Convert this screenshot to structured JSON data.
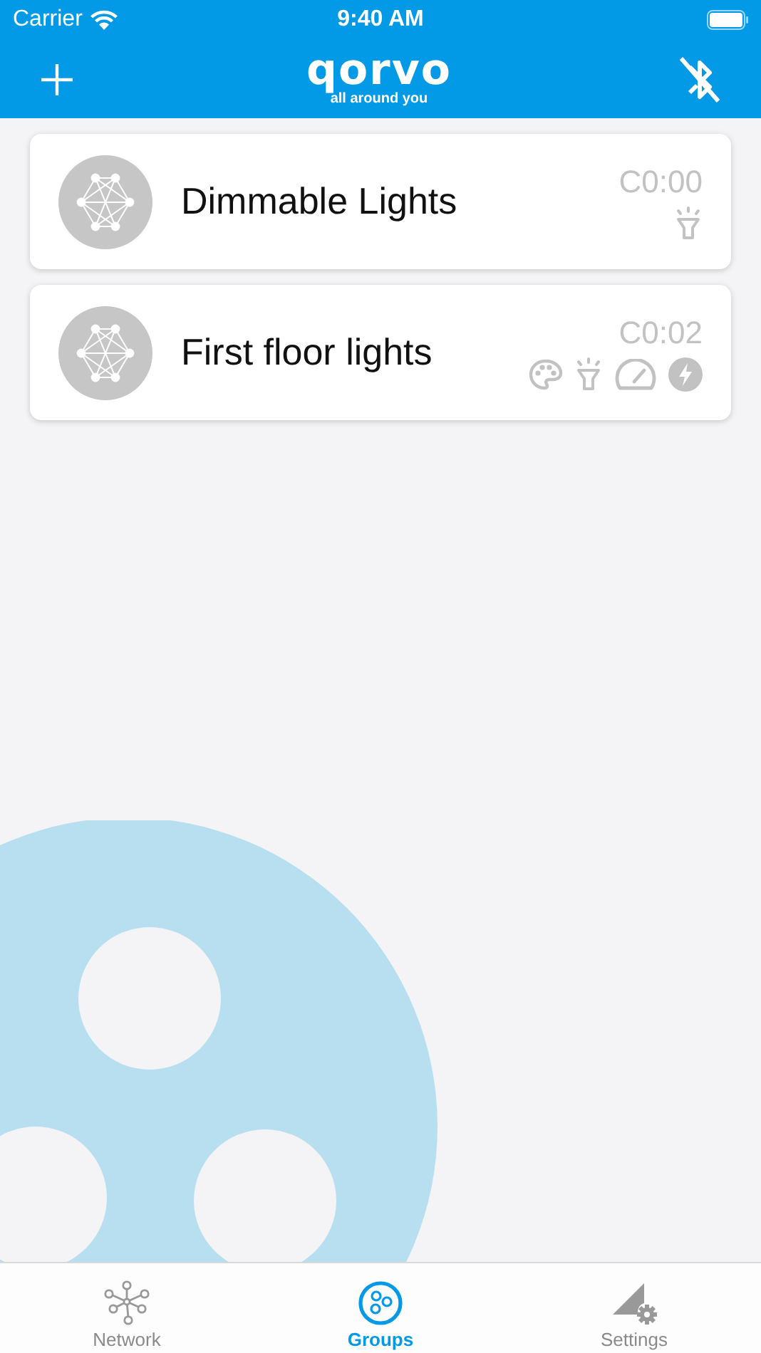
{
  "status_bar": {
    "carrier": "Carrier",
    "time": "9:40 AM"
  },
  "nav_bar": {
    "logo": "qorvo",
    "tagline": "all around you"
  },
  "groups": [
    {
      "name": "Dimmable Lights",
      "code": "C0:00",
      "capabilities": [
        {
          "kind": "dimmer"
        }
      ]
    },
    {
      "name": "First floor lights",
      "code": "C0:02",
      "capabilities": [
        {
          "kind": "color"
        },
        {
          "kind": "dimmer"
        },
        {
          "kind": "level"
        },
        {
          "kind": "power"
        }
      ]
    }
  ],
  "tabs": [
    {
      "label": "Network",
      "kind": "network",
      "selected": false
    },
    {
      "label": "Groups",
      "kind": "groups",
      "selected": true
    },
    {
      "label": "Settings",
      "kind": "settings",
      "selected": false
    }
  ]
}
